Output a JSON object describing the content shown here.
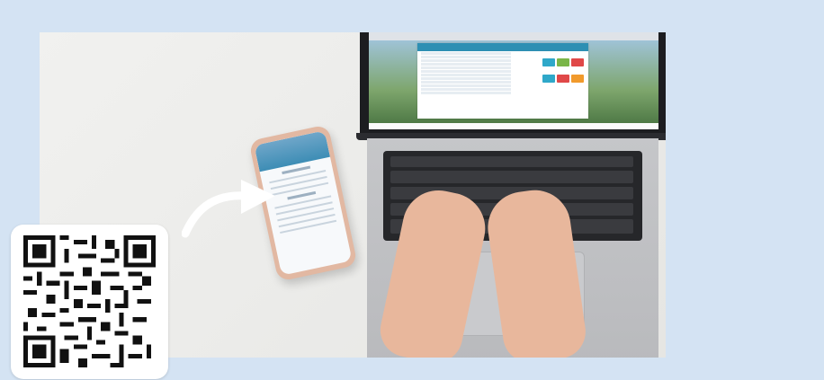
{
  "image": {
    "type": "photo-card",
    "background_color": "#d4e3f3",
    "scene": "hands-typing-on-laptop-with-phone-beside",
    "qr_code": {
      "present": true
    }
  }
}
